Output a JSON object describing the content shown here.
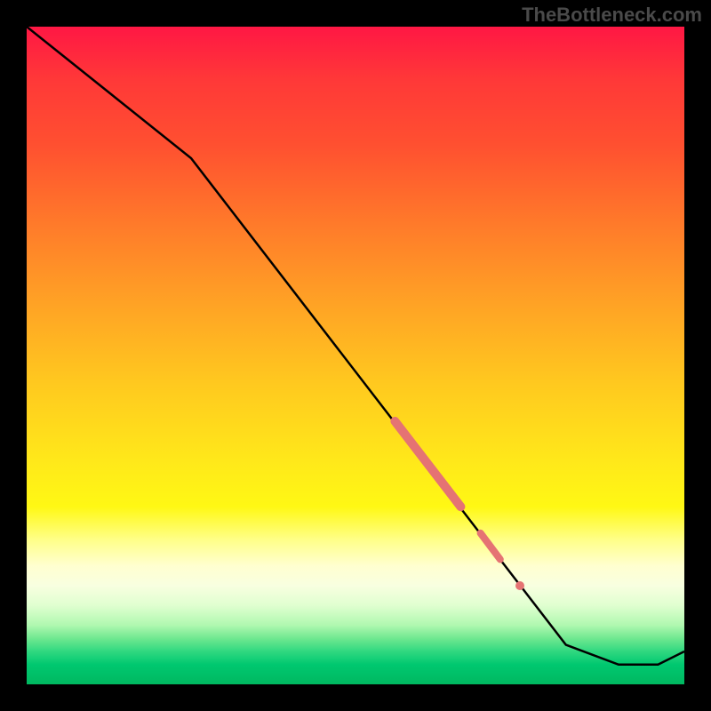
{
  "watermark": "TheBottleneck.com",
  "chart_data": {
    "type": "line",
    "title": "",
    "xlabel": "",
    "ylabel": "",
    "xlim": [
      0,
      100
    ],
    "ylim": [
      0,
      100
    ],
    "background_gradient": {
      "top_color": "#ff1744",
      "mid_color": "#ffe81a",
      "bottom_color": "#00c870",
      "description": "vertical gradient red→orange→yellow→green representing bottleneck severity"
    },
    "series": [
      {
        "name": "bottleneck-curve",
        "type": "line",
        "color": "#000000",
        "points": [
          {
            "x": 0,
            "y": 100
          },
          {
            "x": 25,
            "y": 80
          },
          {
            "x": 82,
            "y": 6
          },
          {
            "x": 90,
            "y": 3
          },
          {
            "x": 96,
            "y": 3
          },
          {
            "x": 100,
            "y": 5
          }
        ]
      },
      {
        "name": "highlight-segment-main",
        "type": "line",
        "color": "#e57373",
        "stroke_width": 8,
        "points": [
          {
            "x": 56,
            "y": 40
          },
          {
            "x": 66,
            "y": 27
          }
        ]
      },
      {
        "name": "highlight-segment-secondary",
        "type": "line",
        "color": "#e57373",
        "stroke_width": 7,
        "points": [
          {
            "x": 69,
            "y": 23
          },
          {
            "x": 72,
            "y": 19
          }
        ]
      },
      {
        "name": "highlight-dot",
        "type": "scatter",
        "color": "#e57373",
        "points": [
          {
            "x": 75,
            "y": 15
          }
        ]
      }
    ]
  }
}
